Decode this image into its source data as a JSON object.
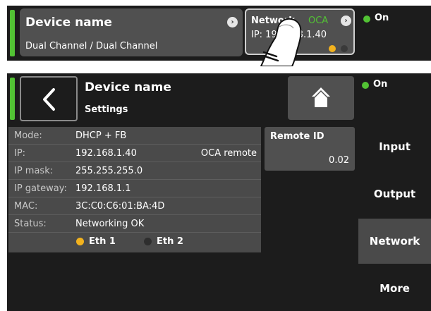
{
  "top": {
    "device_tile": {
      "title": "Device name",
      "subtitle": "Dual Channel / Dual Channel"
    },
    "network_tile": {
      "title": "Network",
      "oca": "OCA",
      "ip": "IP: 192.168.1.40"
    },
    "status": "On"
  },
  "header": {
    "title": "Device name",
    "subtitle": "Settings",
    "status": "On"
  },
  "info": {
    "rows": [
      {
        "label": "Mode:",
        "value": "DHCP + FB",
        "extra": ""
      },
      {
        "label": "IP:",
        "value": "192.168.1.40",
        "extra": "OCA remote"
      },
      {
        "label": "IP mask:",
        "value": "255.255.255.0",
        "extra": ""
      },
      {
        "label": "IP gateway:",
        "value": "192.168.1.1",
        "extra": ""
      },
      {
        "label": "MAC:",
        "value": "3C:C0:C6:01:BA:4D",
        "extra": ""
      },
      {
        "label": "Status:",
        "value": "Networking OK",
        "extra": ""
      }
    ],
    "eth1": "Eth 1",
    "eth2": "Eth 2"
  },
  "remote": {
    "label": "Remote ID",
    "value": "0.02"
  },
  "tabs": [
    {
      "label": "Input",
      "active": false
    },
    {
      "label": "Output",
      "active": false
    },
    {
      "label": "Network",
      "active": true
    },
    {
      "label": "More",
      "active": false
    }
  ],
  "colors": {
    "on_green": "#52c234",
    "oca_green": "#52c234",
    "eth_active": "#f2b21e",
    "eth_inactive": "#3a3a3a"
  },
  "icons": {
    "back": "chevron-left-icon",
    "home": "home-icon",
    "arrow": "circle-arrow-right-icon",
    "finger": "hand-pointer-icon"
  }
}
